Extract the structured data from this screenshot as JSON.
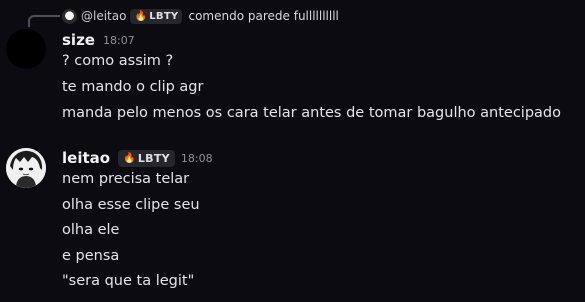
{
  "reply": {
    "username": "@leitao",
    "tag": "LBTY",
    "text": "comendo parede fullllllllll"
  },
  "messages": [
    {
      "username": "size",
      "timestamp": "18:07",
      "lines": [
        "? como assim ?",
        "te mando o clip agr",
        "manda pelo menos os cara telar antes de tomar bagulho antecipado"
      ]
    },
    {
      "username": "leitao",
      "tag": "LBTY",
      "timestamp": "18:08",
      "lines": [
        "nem precisa telar",
        "olha esse clipe seu",
        "olha ele",
        "e pensa",
        "\"sera que ta legit\""
      ]
    }
  ],
  "colors": {
    "background": "#0d0b12",
    "tag_background": "#26262d",
    "fire": "#ff7a2a"
  }
}
